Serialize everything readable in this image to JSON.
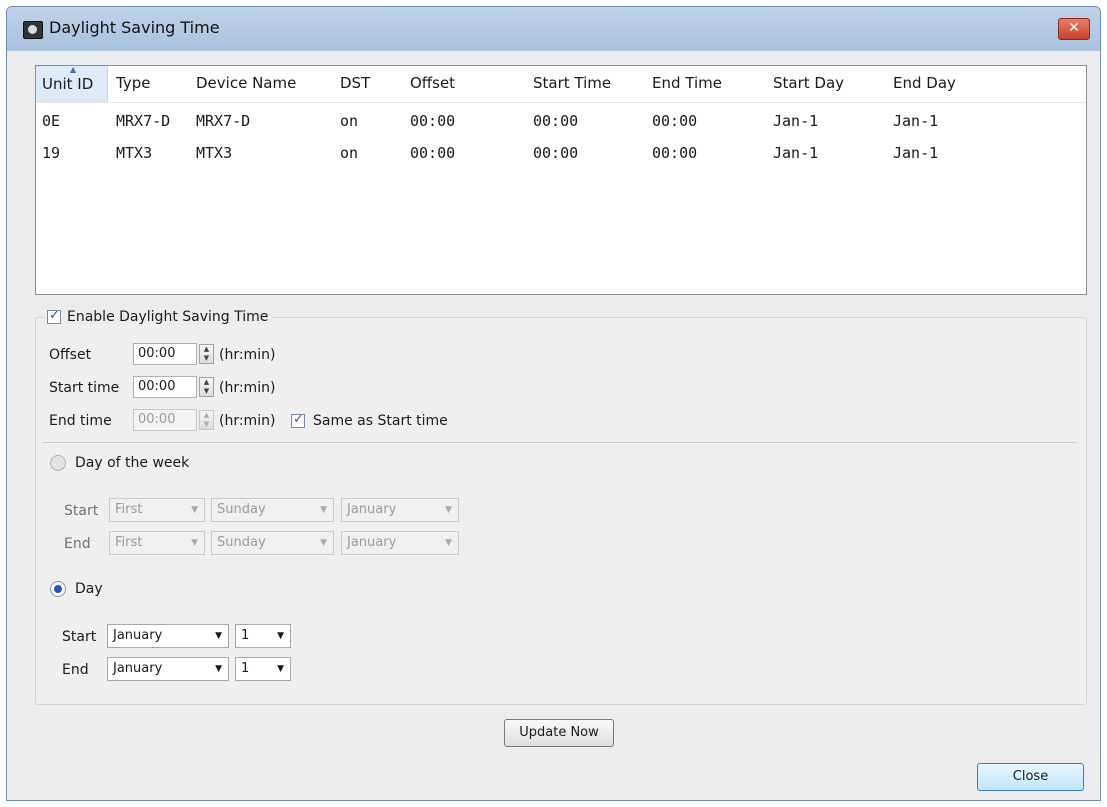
{
  "window": {
    "title": "Daylight Saving Time",
    "close_glyph": "✕"
  },
  "table": {
    "sort_glyph": "▲",
    "columns": [
      "Unit ID",
      "Type",
      "Device Name",
      "DST",
      "Offset",
      "Start Time",
      "End Time",
      "Start Day",
      "End Day"
    ],
    "rows": [
      [
        "0E",
        "MRX7-D",
        "MRX7-D",
        "on",
        "00:00",
        "00:00",
        "00:00",
        "Jan-1",
        "Jan-1"
      ],
      [
        "19",
        "MTX3",
        "MTX3",
        "on",
        "00:00",
        "00:00",
        "00:00",
        "Jan-1",
        "Jan-1"
      ]
    ]
  },
  "dst": {
    "enable_label": "Enable Daylight Saving Time",
    "enabled": true,
    "offset_label": "Offset",
    "offset_value": "00:00",
    "start_time_label": "Start time",
    "start_time_value": "00:00",
    "end_time_label": "End time",
    "end_time_value": "00:00",
    "unit": "(hr:min)",
    "same_as_start_label": "Same as Start time",
    "same_as_start": true
  },
  "week_mode": {
    "label": "Day of the week",
    "selected": false,
    "start_label": "Start",
    "end_label": "End",
    "start": {
      "week": "First",
      "weekday": "Sunday",
      "month": "January"
    },
    "end": {
      "week": "First",
      "weekday": "Sunday",
      "month": "January"
    }
  },
  "day_mode": {
    "label": "Day",
    "selected": true,
    "start_label": "Start",
    "end_label": "End",
    "start": {
      "month": "January",
      "day": "1"
    },
    "end": {
      "month": "January",
      "day": "1"
    }
  },
  "buttons": {
    "update_now": "Update Now",
    "close": "Close"
  },
  "glyphs": {
    "spin_up": "▲",
    "spin_down": "▼",
    "dropdown": "▼"
  }
}
